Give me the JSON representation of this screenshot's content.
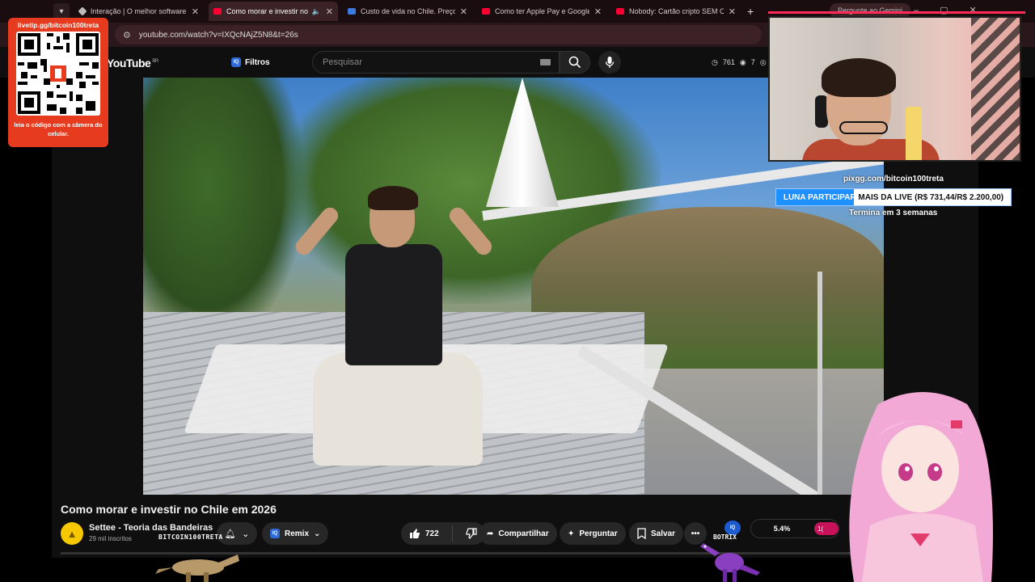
{
  "browser": {
    "tabs": [
      {
        "title": "Interação | O melhor software",
        "icon": "diamond-icon",
        "active": false
      },
      {
        "title": "Como morar e investir no C",
        "icon": "youtube-icon",
        "active": true
      },
      {
        "title": "Custo de vida no Chile. Preços",
        "icon": "doc-icon",
        "active": false
      },
      {
        "title": "Como ter Apple Pay e Google P",
        "icon": "youtube-icon",
        "active": false
      },
      {
        "title": "Nobody: Cartão cripto SEM CPF",
        "icon": "youtube-icon",
        "active": false
      }
    ],
    "new_tab_label": "+",
    "gemini_label": "Pergunte ao Gemini",
    "url": "youtube.com/watch?v=IXQcNAjZ5N8&t=26s"
  },
  "youtube": {
    "logo": "YouTube",
    "logo_region": "BR",
    "filters_label": "Filtros",
    "search_placeholder": "Pesquisar",
    "stats": {
      "time": "761",
      "views": "7",
      "viewers": "3"
    }
  },
  "video": {
    "title": "Como morar e investir no Chile em 2026",
    "channel": "Settee - Teoria das Bandeiras",
    "subscribers": "29 mil inscritos",
    "remix_label": "Remix",
    "likes": "722",
    "share_label": "Compartilhar",
    "ask_label": "Perguntar",
    "save_label": "Salvar",
    "more_label": "•••"
  },
  "overlays": {
    "qr_url": "livetip.gg/bitcoin100treta",
    "qr_hint": "leia o código com a câmera do celular.",
    "goal_url": "pixgg.com/bitcoin100treta",
    "goal_text_filled": "LUNA PARTICIPAR",
    "goal_text_rest": " MAIS DA LIVE (R$ 731,44/R$ 2.200,00)",
    "goal_progress": 0.332,
    "goal_ends": "Termina em 3 semanas",
    "bitcoin_tag": "BITCOIN100TRETA",
    "botrix_label": "BOTRIX",
    "iq_badge": "IQ",
    "poll_percent": "5.4%",
    "poll_bar_label": "1("
  },
  "colors": {
    "qr_bg": "#e63b1f",
    "goal_fill": "#1e90ff",
    "yt_bg": "#0f0f0f",
    "accent_red": "#ff2b56"
  }
}
